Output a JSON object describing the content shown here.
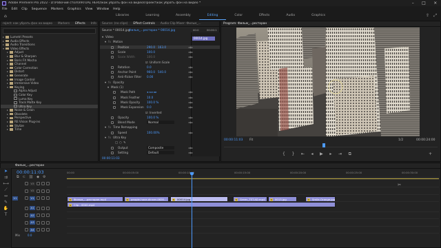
{
  "app": {
    "title": "Adobe Premiere Pro 2022 - D:\\Рабочий стол\\VIRTUAL HERO\\как убрать фон на видео\\Проект\\как убрать фон на видео *"
  },
  "menu": [
    "File",
    "Edit",
    "Clip",
    "Sequence",
    "Markers",
    "Graphics",
    "View",
    "Window",
    "Help"
  ],
  "workspaces": {
    "tabs": [
      "Libraries",
      "Learning",
      "Assembly",
      "Editing",
      "Color",
      "Effects",
      "Audio",
      "Graphics"
    ],
    "active": "Editing"
  },
  "effects_panel": {
    "tabs": [
      "roject: как убрать фон на видео",
      "Markers",
      "Effects",
      "Info"
    ],
    "active_tab": "Effects",
    "tree": [
      {
        "label": "Lumetri Presets",
        "type": "folder",
        "depth": 0
      },
      {
        "label": "Audio Effects",
        "type": "folder",
        "depth": 0
      },
      {
        "label": "Audio Transitions",
        "type": "folder",
        "depth": 0
      },
      {
        "label": "Video Effects",
        "type": "folder",
        "depth": 0,
        "open": true
      },
      {
        "label": "Adjust",
        "type": "folder",
        "depth": 1
      },
      {
        "label": "Blur & Sharpen",
        "type": "folder",
        "depth": 1
      },
      {
        "label": "Boris FX Mocha",
        "type": "folder",
        "depth": 1
      },
      {
        "label": "Channel",
        "type": "folder",
        "depth": 1
      },
      {
        "label": "Color Correction",
        "type": "folder",
        "depth": 1
      },
      {
        "label": "Distort",
        "type": "folder",
        "depth": 1
      },
      {
        "label": "Generate",
        "type": "folder",
        "depth": 1
      },
      {
        "label": "Image Control",
        "type": "folder",
        "depth": 1
      },
      {
        "label": "Immersive Video",
        "type": "folder",
        "depth": 1
      },
      {
        "label": "Keying",
        "type": "folder",
        "depth": 1,
        "open": true
      },
      {
        "label": "Alpha Adjust",
        "type": "fx",
        "depth": 2
      },
      {
        "label": "Color Key",
        "type": "fx",
        "depth": 2
      },
      {
        "label": "Luma Key",
        "type": "fx",
        "depth": 2
      },
      {
        "label": "Track Matte Key",
        "type": "fx",
        "depth": 2
      },
      {
        "label": "Ultra Key",
        "type": "fx",
        "depth": 2,
        "selected": true
      },
      {
        "label": "Noise & Grain",
        "type": "folder",
        "depth": 1
      },
      {
        "label": "Obsolete",
        "type": "folder",
        "depth": 1
      },
      {
        "label": "Perspective",
        "type": "folder",
        "depth": 1
      },
      {
        "label": "RE:Vision Plug-ins",
        "type": "folder",
        "depth": 1
      },
      {
        "label": "Stylize",
        "type": "folder",
        "depth": 1
      },
      {
        "label": "Time",
        "type": "folder",
        "depth": 1
      }
    ]
  },
  "effect_controls": {
    "tabs": [
      "Source: (no clips)",
      "Effect Controls",
      "Audio Clip Mixer: Фильм_..."
    ],
    "active_tab": "Effect Controls",
    "source_label": "Source * 00014.jpg",
    "sequence_label": "Фильм_...ресторан * 00014.jpg",
    "ruler_start": "00:0",
    "ruler_end": "00:00:1",
    "clip_label": "00014.jpg",
    "rows": [
      {
        "label": "Video",
        "depth": 0,
        "kind": "header"
      },
      {
        "label": "Motion",
        "depth": 1,
        "kind": "fx"
      },
      {
        "label": "Position",
        "depth": 2,
        "v1": "290.0",
        "v2": "163.0",
        "selected": true
      },
      {
        "label": "Scale",
        "depth": 2,
        "v1": "100.0"
      },
      {
        "label": "Scale Width",
        "depth": 2,
        "v1": "100.0",
        "dim": true
      },
      {
        "label": "",
        "depth": 2,
        "check": "Uniform Scale"
      },
      {
        "label": "Rotation",
        "depth": 2,
        "v1": "0.0"
      },
      {
        "label": "Anchor Point",
        "depth": 2,
        "v1": "960.0",
        "v2": "540.0"
      },
      {
        "label": "Anti-flicker Filter",
        "depth": 2,
        "v1": "0.00"
      },
      {
        "label": "Opacity",
        "depth": 1,
        "kind": "fx"
      },
      {
        "label": "Mask (1)",
        "depth": 2,
        "kind": "mask"
      },
      {
        "label": "Mask Path",
        "depth": 3,
        "v1": "◂ ◂ ▸ ▸▸"
      },
      {
        "label": "Mask Feather",
        "depth": 3,
        "v1": "10.0"
      },
      {
        "label": "Mask Opacity",
        "depth": 3,
        "v1": "100.0 %"
      },
      {
        "label": "Mask Expansion",
        "depth": 3,
        "v1": "0.0"
      },
      {
        "label": "",
        "depth": 3,
        "check": "Inverted"
      },
      {
        "label": "Opacity",
        "depth": 2,
        "v1": "100.0 %"
      },
      {
        "label": "Blend Mode",
        "depth": 2,
        "v1": "Normal",
        "dropdown": true
      },
      {
        "label": "Time Remapping",
        "depth": 1,
        "kind": "fx"
      },
      {
        "label": "Speed",
        "depth": 2,
        "v1": "100.00%"
      },
      {
        "label": "Ultra Key",
        "depth": 1,
        "kind": "fx"
      },
      {
        "label": "",
        "depth": 2,
        "kind": "shapes"
      },
      {
        "label": "Output",
        "depth": 2,
        "v1": "Composite",
        "dropdown": true
      },
      {
        "label": "Setting",
        "depth": 2,
        "v1": "Default",
        "dropdown": true
      }
    ],
    "timecode": "00:00:11:03"
  },
  "program_monitor": {
    "title": "Program: Фильм_...ресторан",
    "timecode": "00:00:11:03",
    "fit": "Fit",
    "quality": "1/2",
    "duration": "00:00:24:00"
  },
  "timeline": {
    "tab": "Фильм_...ресторан",
    "timecode": "00:00:11:03",
    "ruler": [
      "00:00",
      "00:00:05:00",
      "00:00:10:00",
      "00:00:15:00",
      "00:00:20:00",
      "00:00:25:00",
      "00:00:30:00"
    ],
    "tracks": [
      {
        "id": "V3",
        "target": false
      },
      {
        "id": "V2",
        "target": false
      },
      {
        "id": "V1",
        "target": true
      },
      {
        "id": "A1",
        "target": true
      },
      {
        "id": "A2",
        "target": true
      },
      {
        "id": "A3",
        "target": true
      },
      {
        "id": "A4",
        "target": true
      }
    ],
    "v1_label": "V1",
    "mix_label": "Mix",
    "mix_value": "0.0",
    "v2_clips": [
      {
        "label": "Фильм_...ресторан.mp4",
        "color": "#8f8fd8"
      },
      {
        "label": "people-have-dinner-4K00...",
        "color": "#8f8fd8"
      },
      {
        "label": "00014.jpg",
        "color": "#bdbdf0"
      },
      {
        "label": "Green_TST.AD.mp4",
        "color": "#8f8fd8"
      },
      {
        "label": "0013.jpg",
        "color": "#8f8fd8"
      },
      {
        "label": "Smile-Orange.jpg",
        "color": "#8f8fd8"
      }
    ],
    "v1_clips": [
      {
        "label": "Clip - 0040.mp4",
        "color": "#8f8fd8"
      }
    ]
  },
  "tools": [
    "select",
    "track-select",
    "ripple",
    "razor",
    "slip",
    "pen",
    "hand",
    "type"
  ],
  "colors": {
    "accent": "#4d9bff",
    "clip": "#8f8fd8",
    "clip_selected": "#bdbdf0",
    "playhead": "#4d9bff"
  }
}
